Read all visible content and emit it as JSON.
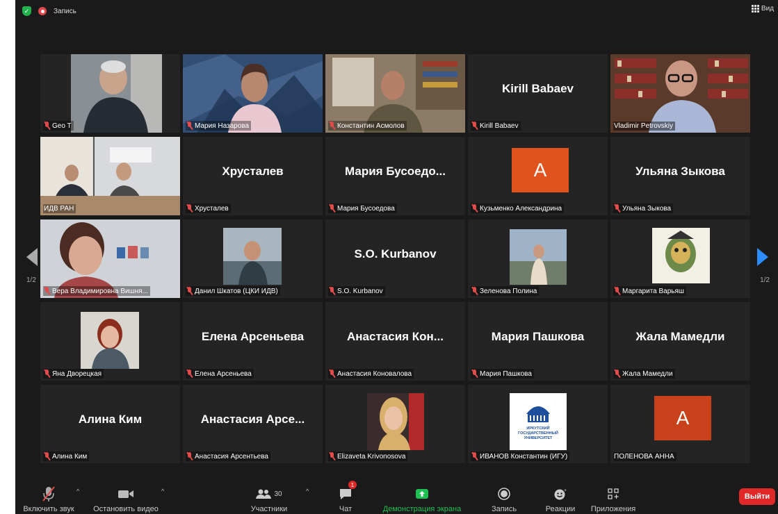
{
  "topbar": {
    "recording_label": "Запись",
    "view_label": "Вид"
  },
  "pagination": {
    "left_page": "1/2",
    "right_page": "1/2"
  },
  "tiles": [
    {
      "name": "Geo T",
      "big": "",
      "video": true
    },
    {
      "name": "Мария Назарова",
      "big": "",
      "video": true
    },
    {
      "name": "Константин Асмолов",
      "big": "",
      "video": true
    },
    {
      "name": "Kirill Babaev",
      "big": "Kirill Babaev",
      "video": false
    },
    {
      "name": "Vladimir Petrovskiy",
      "big": "",
      "video": true,
      "active": true
    },
    {
      "name": "ИДВ РАН",
      "big": "",
      "video": true
    },
    {
      "name": "Хрусталев",
      "big": "Хрусталев",
      "video": false
    },
    {
      "name": "Мария Бусоедова",
      "big": "Мария  Бусоедо...",
      "video": false
    },
    {
      "name": "Кузьменко Александрина",
      "big": "",
      "avatar": "A"
    },
    {
      "name": "Ульяна Зыкова",
      "big": "Ульяна Зыкова",
      "video": false
    },
    {
      "name": "Вера Владимировна Вишня...",
      "big": "",
      "video": true
    },
    {
      "name": "Данил Шкатов (ЦКИ ИДВ)",
      "big": "",
      "video": true
    },
    {
      "name": "S.O. Kurbanov",
      "big": "S.O. Kurbanov",
      "video": false
    },
    {
      "name": "Зеленова Полина",
      "big": "",
      "video": true
    },
    {
      "name": "Маргарита Варьяш",
      "big": "",
      "video": true
    },
    {
      "name": "Яна Дворецкая",
      "big": "",
      "video": true
    },
    {
      "name": "Елена Арсеньева",
      "big": "Елена Арсеньева",
      "video": false
    },
    {
      "name": "Анастасия Коновалова",
      "big": "Анастасия  Кон...",
      "video": false
    },
    {
      "name": "Мария Пашкова",
      "big": "Мария Пашкова",
      "video": false
    },
    {
      "name": "Жала Мамедли",
      "big": "Жала Мамедли",
      "video": false
    },
    {
      "name": "Алина Ким",
      "big": "Алина Ким",
      "video": false
    },
    {
      "name": "Анастасия Арсентьева",
      "big": "Анастасия  Арсе...",
      "video": false
    },
    {
      "name": "Elizaveta Krivonosova",
      "big": "",
      "video": true
    },
    {
      "name": "ИВАНОВ Константин (ИГУ)",
      "big": "",
      "video": true,
      "logo_text": "ИРКУТСКИЙ ГОСУДАРСТВЕННЫЙ УНИВЕРСИТЕТ"
    },
    {
      "name": "ПОЛЕНОВА АННА",
      "big": "",
      "avatar": "A",
      "mic_on": true
    }
  ],
  "toolbar": {
    "unmute": "Включить звук",
    "stop_video": "Остановить видео",
    "participants": "Участники",
    "participants_count": "30",
    "chat": "Чат",
    "chat_badge": "1",
    "share": "Демонстрация экрана",
    "record": "Запись",
    "reactions": "Реакции",
    "apps": "Приложения",
    "leave": "Выйти"
  },
  "colors": {
    "accent_green": "#23b14d",
    "leave_red": "#e02828",
    "avatar_orange": "#e0521e",
    "active_outline": "#cfd448",
    "share_green": "#1fbf53"
  }
}
